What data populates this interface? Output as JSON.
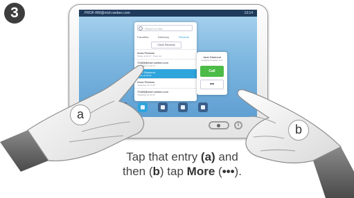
{
  "step": {
    "number": "3"
  },
  "screen": {
    "status_left": "PROF-RM@mich.webex.com",
    "status_right": "13:14",
    "search_placeholder": "Search or Dial",
    "tabs": [
      "Favorites",
      "Directory",
      "Recents"
    ],
    "clear_label": "Clear Recents",
    "recents": [
      {
        "name": "Anna Pearson",
        "detail": "Today, at 10:17 · 8 sec out"
      },
      {
        "name": "70483@mich.webex.com",
        "detail": "Yesterday, at 21:10"
      },
      {
        "name": "Jane Diamond",
        "detail": "Today, at 10:19"
      },
      {
        "name": "Anna Pearson",
        "detail": "Yesterday, at 17:35"
      },
      {
        "name": "70483@mich.webex.com",
        "detail": "Yesterday, at 13:43"
      }
    ],
    "selected_index": 2,
    "popup": {
      "name": "Jane Diamond",
      "address": "jane@mich.webex.com",
      "call_label": "Call",
      "more_label": "•••"
    }
  },
  "device": {
    "info_glyph": "i"
  },
  "labels": {
    "a": "a",
    "b": "b"
  },
  "caption": {
    "line1_pre": "Tap that entry ",
    "line1_key": "(a)",
    "line1_post": " and",
    "line2_pre": "then (",
    "line2_key_b": "b",
    "line2_mid": ") tap ",
    "line2_key_more": "More",
    "line2_paren_open": " (",
    "line2_dots": "•••",
    "line2_end": ")."
  },
  "colors": {
    "accent": "#2ea4dc",
    "call_green": "#4cbb47",
    "status_bar": "#1f3b5c"
  }
}
